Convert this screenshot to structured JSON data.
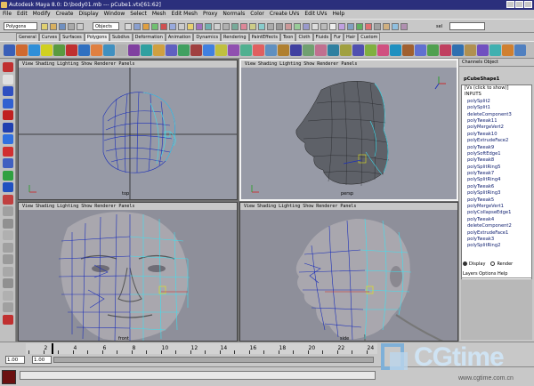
{
  "window": {
    "title": "Autodesk Maya 8.0: D:\\body01.mb  ---  pCube1.vtx[61:62]"
  },
  "menu": [
    "File",
    "Edit",
    "Modify",
    "Create",
    "Display",
    "Window",
    "Select",
    "Mesh",
    "Edit Mesh",
    "Proxy",
    "Normals",
    "Color",
    "Create UVs",
    "Edit UVs",
    "Help"
  ],
  "status": {
    "mode": "Polygons",
    "object_mode": "Objects",
    "sel_label": "sel"
  },
  "shelf_tabs": [
    "General",
    "Curves",
    "Surfaces",
    "Polygons",
    "Subdivs",
    "Deformation",
    "Animation",
    "Dynamics",
    "Rendering",
    "PaintEffects",
    "Toon",
    "Cloth",
    "Fluids",
    "Fur",
    "Hair",
    "Custom"
  ],
  "shelf_active_tab": "Polygons",
  "viewport_menu": "View  Shading  Lighting  Show  Renderer  Panels",
  "viewports": [
    {
      "camera": "top"
    },
    {
      "camera": "persp"
    },
    {
      "camera": "front"
    },
    {
      "camera": "side"
    }
  ],
  "channel_box": {
    "header": "Channels  Object",
    "shape": "pCubeShape1",
    "click_hint": "[Vs (click to show)]",
    "inputs_label": "INPUTS",
    "inputs": [
      "polySplit2",
      "polySplit1",
      "deleteComponent3",
      "polyTweak11",
      "polyMergeVert2",
      "polyTweak10",
      "polyExtrudeFace2",
      "polyTweak9",
      "polySoftEdge1",
      "polyTweak8",
      "polySplitRing5",
      "polyTweak7",
      "polySplitRing4",
      "polyTweak6",
      "polySplitRing3",
      "polyTweak5",
      "polyMergeVert1",
      "polyCollapseEdge1",
      "polyTweak4",
      "deleteComponent2",
      "polyExtrudeFace1",
      "polyTweak3",
      "polySplitRing2"
    ],
    "display_label": "Display",
    "render_label": "Render",
    "layers_menu": "Layers  Options  Help"
  },
  "timeline": {
    "ticks": [
      "2",
      "4",
      "6",
      "8",
      "10",
      "12",
      "14",
      "16",
      "18",
      "20",
      "22",
      "24"
    ],
    "start": "1.00",
    "range_start": "1.00"
  },
  "watermark": {
    "brand": "CGtime",
    "url": "www.cgtime.com.cn"
  },
  "colors": {
    "title_bg": "#2b2f7c",
    "viewport_bg": "#979aa6",
    "wire_blue": "#1c2fb8",
    "wire_cyan": "#3ce0f0",
    "mesh_gray": "#5e6168"
  }
}
